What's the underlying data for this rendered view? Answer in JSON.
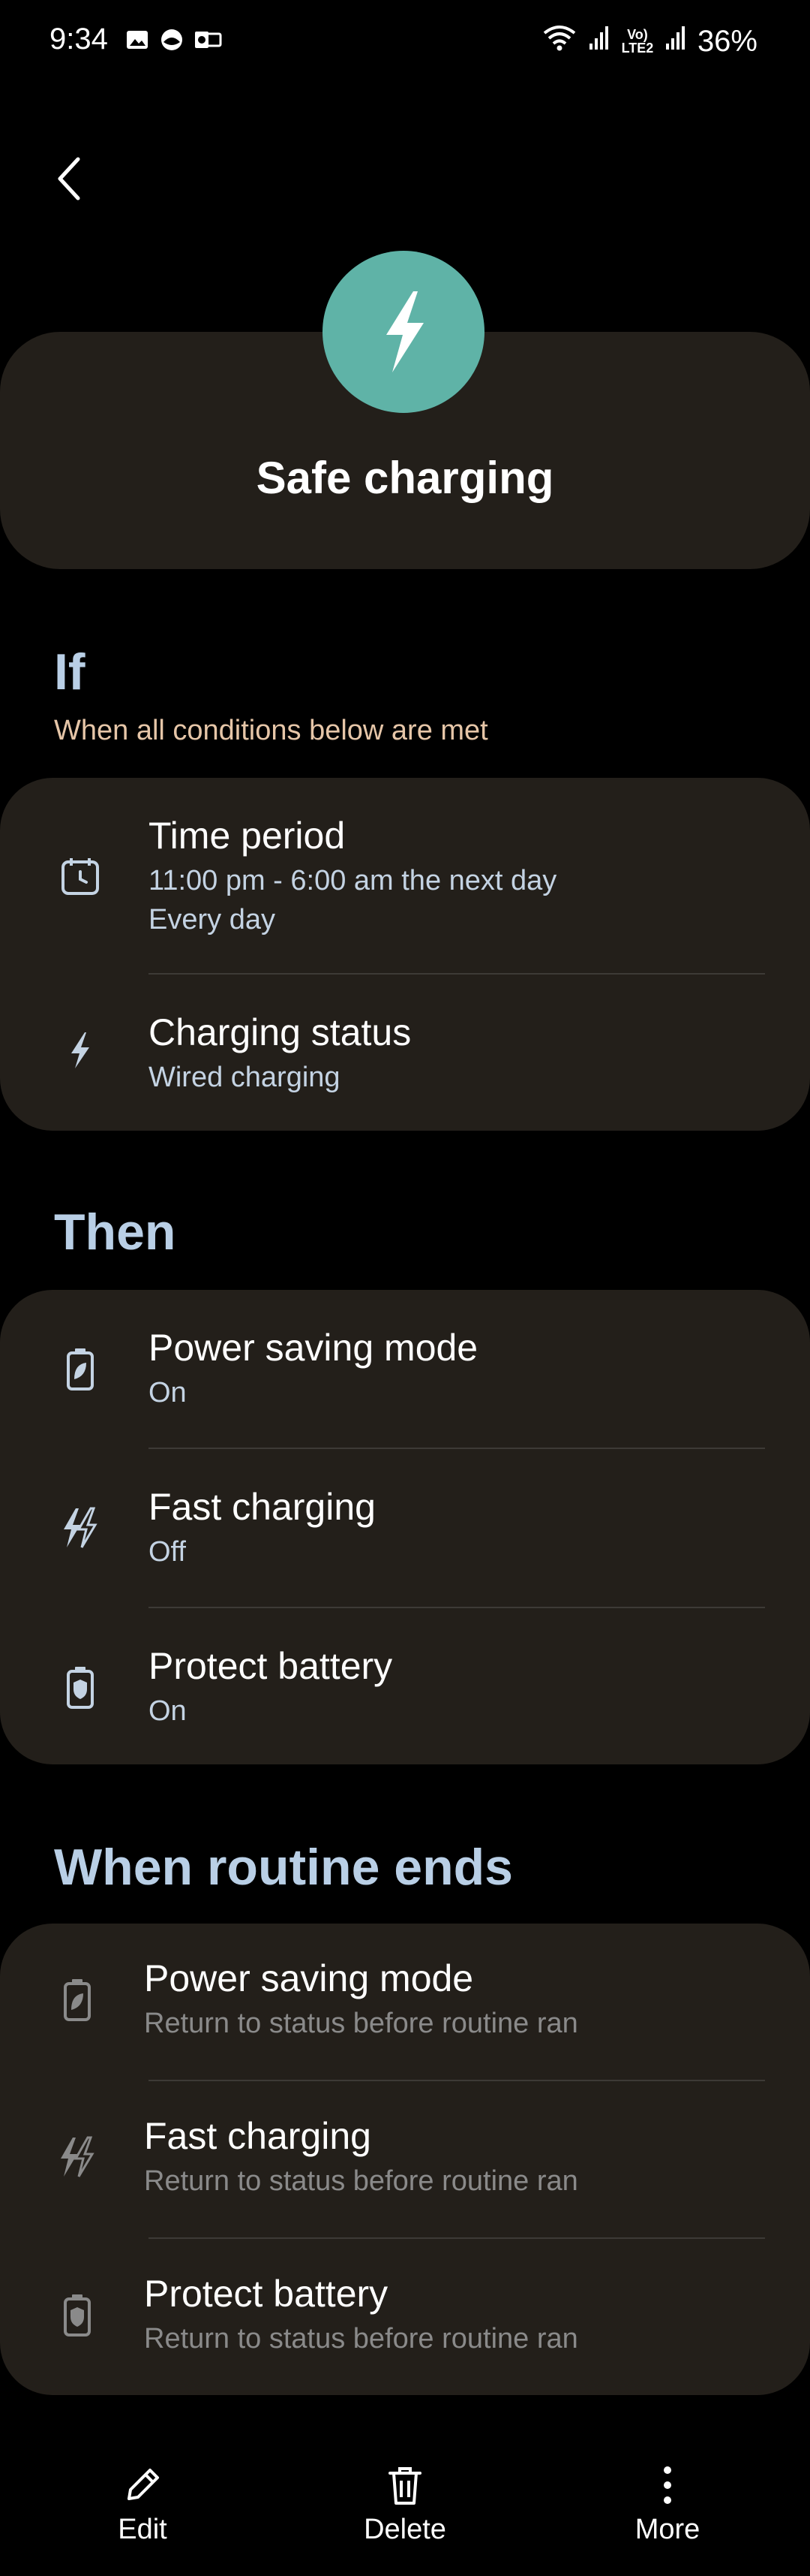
{
  "status_bar": {
    "time": "9:34",
    "battery": "36%",
    "network_label": "Vo) LTE2"
  },
  "header": {
    "title": "Safe charging",
    "icon": "lightning-bolt-icon",
    "icon_color": "#5fb3a7"
  },
  "if_section": {
    "heading": "If",
    "subtitle": "When all conditions below are met",
    "items": [
      {
        "title": "Time period",
        "line1": "11:00  pm - 6:00  am the next day",
        "line2": "Every day",
        "icon": "clock-calendar-icon"
      },
      {
        "title": "Charging status",
        "line1": "Wired charging",
        "icon": "charging-bolt-icon"
      }
    ]
  },
  "then_section": {
    "heading": "Then",
    "items": [
      {
        "title": "Power saving mode",
        "value": "On",
        "icon": "power-saving-battery-icon"
      },
      {
        "title": "Fast charging",
        "value": "Off",
        "icon": "fast-charging-icon"
      },
      {
        "title": "Protect battery",
        "value": "On",
        "icon": "protect-battery-icon"
      }
    ]
  },
  "ends_section": {
    "heading": "When routine ends",
    "items": [
      {
        "title": "Power saving mode",
        "value": "Return to status before routine ran",
        "icon": "power-saving-battery-icon"
      },
      {
        "title": "Fast charging",
        "value": "Return to status before routine ran",
        "icon": "fast-charging-icon"
      },
      {
        "title": "Protect battery",
        "value": "Return to status before routine ran",
        "icon": "protect-battery-icon"
      }
    ]
  },
  "bottom_bar": {
    "edit_label": "Edit",
    "delete_label": "Delete",
    "more_label": "More"
  },
  "colors": {
    "background": "#000000",
    "card": "#231f1a",
    "accent_teal": "#5fb3a7",
    "heading_blue": "#b9cfe6",
    "subtitle_peach": "#e6c6a8"
  }
}
